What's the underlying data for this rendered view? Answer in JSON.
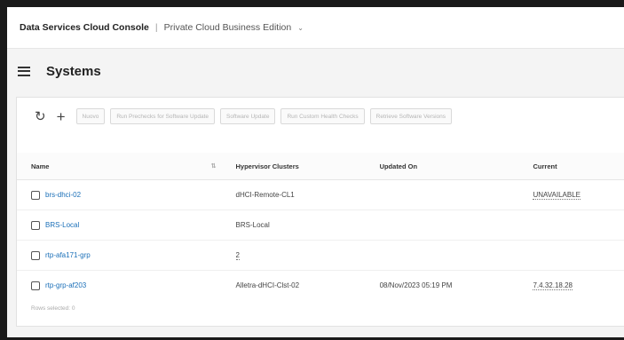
{
  "header": {
    "app_title": "Data Services Cloud Console",
    "separator": "|",
    "edition": "Private Cloud Business Edition",
    "edition_chevron": "chevron-down-icon"
  },
  "page": {
    "title": "Systems",
    "menu_icon": "hamburger-icon"
  },
  "toolbar": {
    "refresh_icon": "refresh-icon",
    "add_icon": "plus-icon",
    "buttons": [
      "Nuovo",
      "Run Prechecks for Software Update",
      "Software Update",
      "Run Custom Health Checks",
      "Retrieve Software Versions"
    ]
  },
  "table": {
    "headers": [
      "Name",
      "Hypervisor Clusters",
      "Updated On",
      "Current"
    ],
    "rows": [
      {
        "name": "brs-dhci-02",
        "hypervisor": "dHCI-Remote-CL1",
        "updated": "",
        "current": "UNAVAILABLE"
      },
      {
        "name": "BRS-Local",
        "hypervisor": "BRS-Local",
        "updated": "",
        "current": ""
      },
      {
        "name": "rtp-afa171-grp",
        "hypervisor": "2",
        "updated": "",
        "current": ""
      },
      {
        "name": "rtp-grp-af203",
        "hypervisor": "Alletra-dHCI-Clst-02",
        "updated": "08/Nov/2023 05:19 PM",
        "current": "7.4.32.18.28"
      }
    ]
  },
  "footer": {
    "rows_selected": "Rows selected: 0"
  }
}
